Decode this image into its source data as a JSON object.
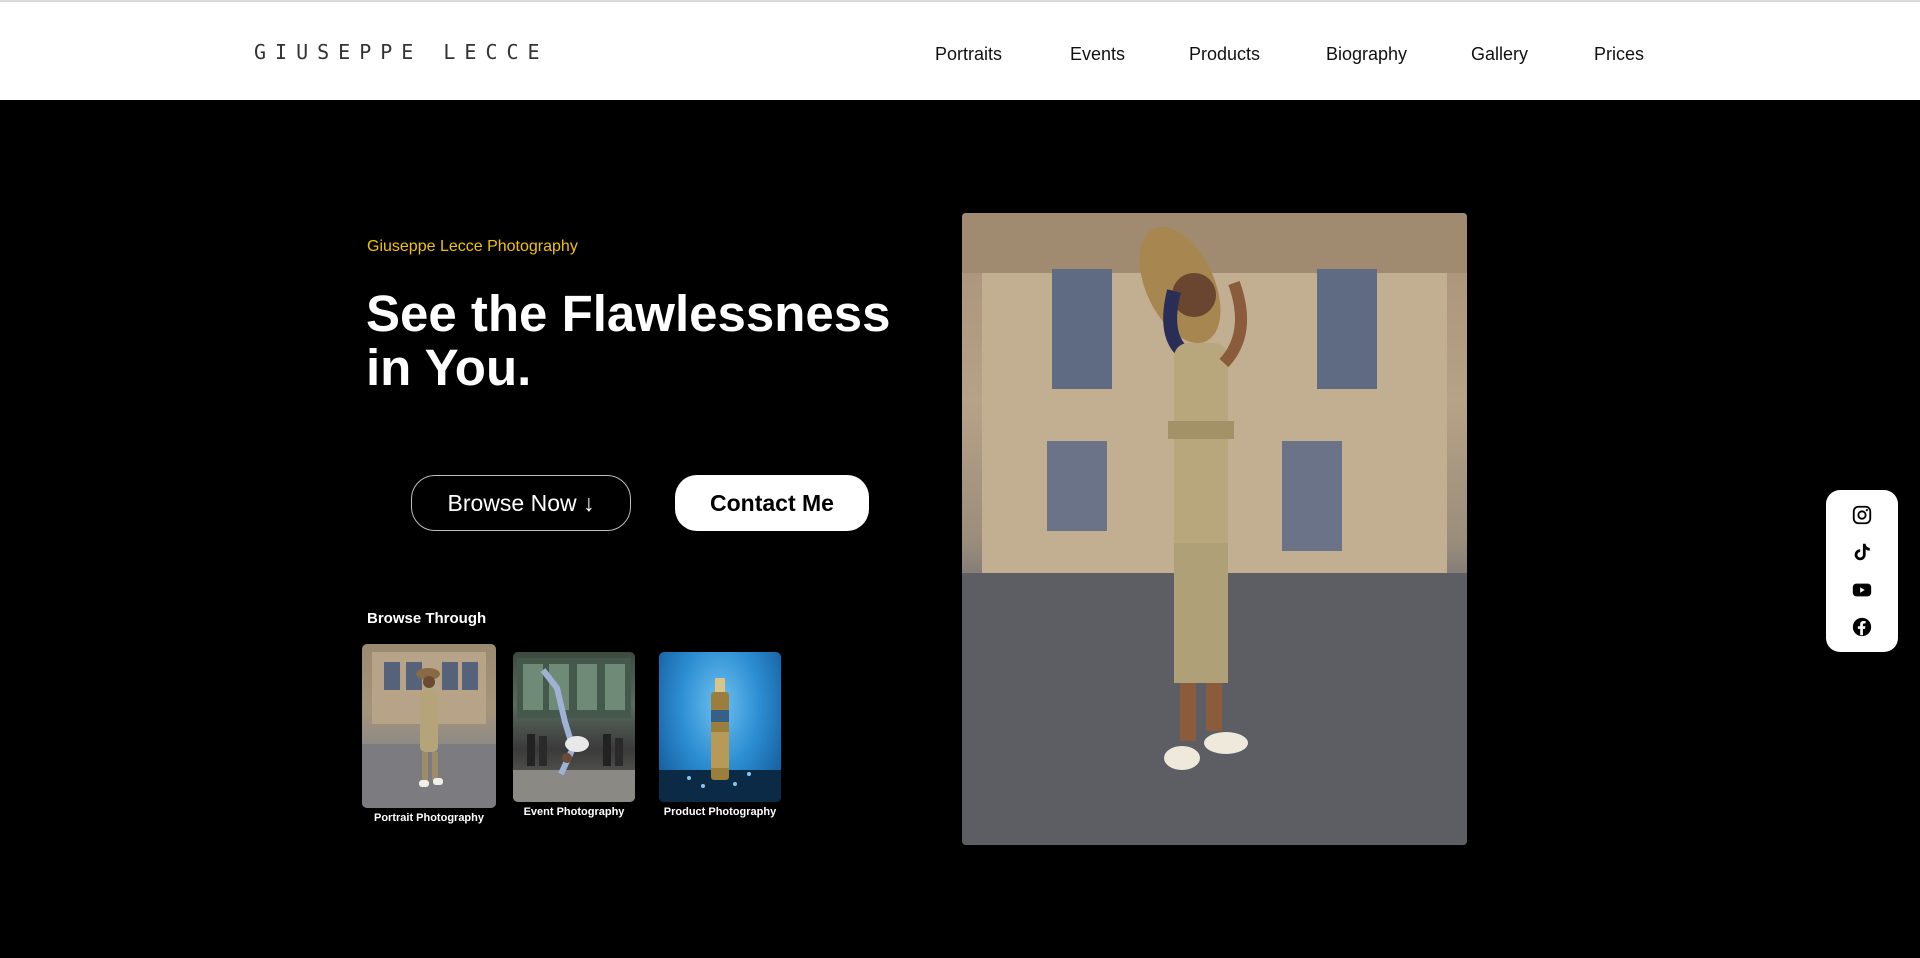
{
  "header": {
    "logo": "GIUSEPPE LECCE",
    "nav": [
      "Portraits",
      "Events",
      "Products",
      "Biography",
      "Gallery",
      "Prices"
    ]
  },
  "hero": {
    "kicker": "Giuseppe Lecce Photography",
    "headline": "See the Flawlessness in You.",
    "browse_button": "Browse Now ↓",
    "contact_button": "Contact Me",
    "browse_title": "Browse Through",
    "thumbnails": [
      {
        "caption": "Portrait Photography"
      },
      {
        "caption": "Event Photography"
      },
      {
        "caption": "Product Photography"
      }
    ]
  },
  "social": {
    "icons": [
      "instagram-icon",
      "tiktok-icon",
      "youtube-icon",
      "facebook-icon"
    ]
  },
  "colors": {
    "accent": "#f2c200",
    "background": "#000000",
    "header": "#ffffff"
  }
}
